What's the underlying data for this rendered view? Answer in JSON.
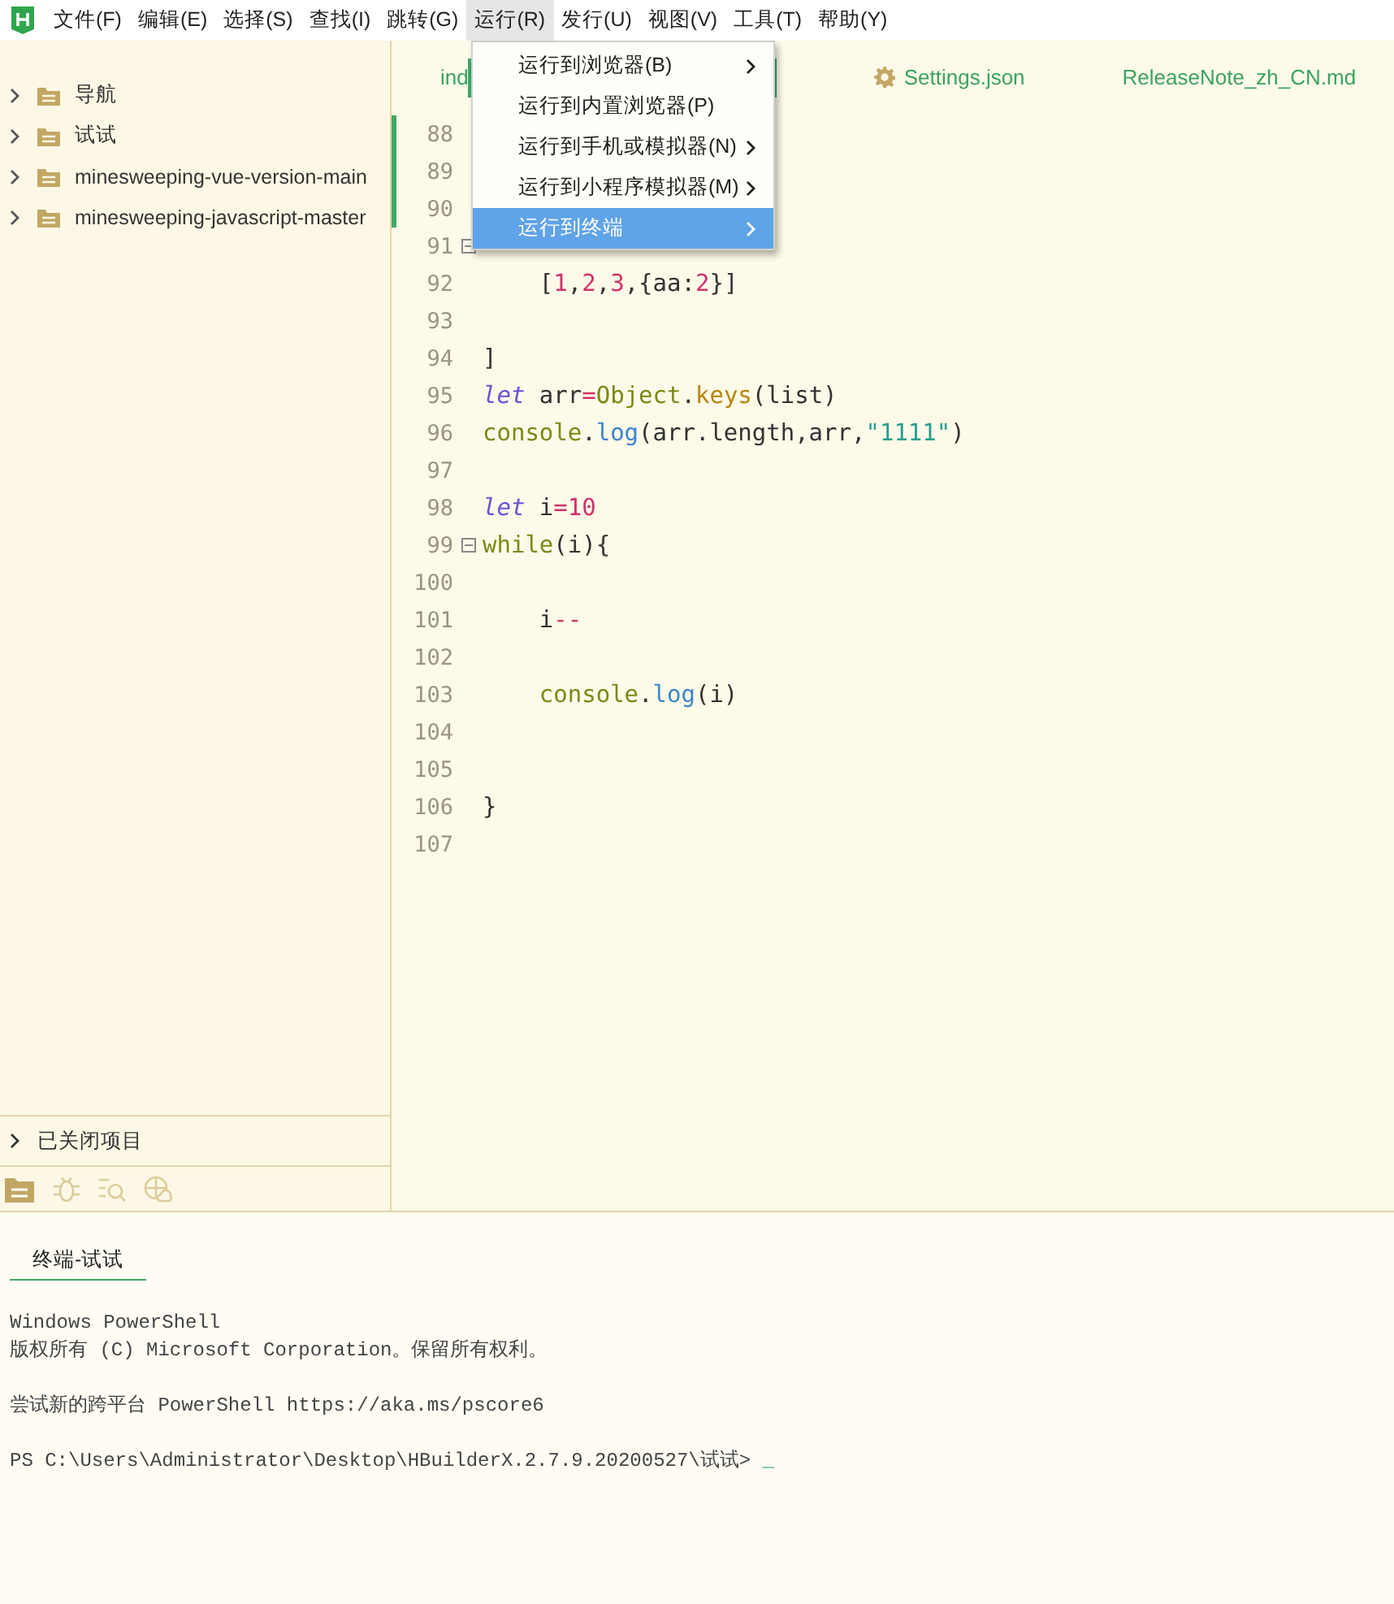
{
  "menubar": {
    "items": [
      {
        "label": "文件(F)",
        "selected": false
      },
      {
        "label": "编辑(E)",
        "selected": false
      },
      {
        "label": "选择(S)",
        "selected": false
      },
      {
        "label": "查找(I)",
        "selected": false
      },
      {
        "label": "跳转(G)",
        "selected": false
      },
      {
        "label": "运行(R)",
        "selected": true
      },
      {
        "label": "发行(U)",
        "selected": false
      },
      {
        "label": "视图(V)",
        "selected": false
      },
      {
        "label": "工具(T)",
        "selected": false
      },
      {
        "label": "帮助(Y)",
        "selected": false
      }
    ]
  },
  "run_menu": {
    "items": [
      {
        "label": "运行到浏览器(B)",
        "submenu": true,
        "selected": false
      },
      {
        "label": "运行到内置浏览器(P)",
        "submenu": false,
        "selected": false
      },
      {
        "label": "运行到手机或模拟器(N)",
        "submenu": true,
        "selected": false
      },
      {
        "label": "运行到小程序模拟器(M)",
        "submenu": true,
        "selected": false
      },
      {
        "label": "运行到终端",
        "submenu": true,
        "selected": true
      }
    ]
  },
  "sidebar": {
    "items": [
      {
        "label": "导航",
        "expanded": false
      },
      {
        "label": "试试",
        "expanded": false
      },
      {
        "label": "minesweeping-vue-version-main",
        "expanded": false
      },
      {
        "label": "minesweeping-javascript-master",
        "expanded": false
      }
    ],
    "closed_projects": {
      "label": "已关闭项目",
      "expanded": false
    }
  },
  "editor": {
    "tabs": [
      {
        "label": "ind",
        "selected": false,
        "kind": "file"
      },
      {
        "selected": true,
        "kind": "file"
      },
      {
        "label": "Settings.json",
        "selected": false,
        "kind": "settings"
      },
      {
        "label": "ReleaseNote_zh_CN.md",
        "selected": false,
        "kind": "file"
      }
    ],
    "lines": [
      {
        "number": "88",
        "modified": true,
        "fold": false
      },
      {
        "number": "89",
        "modified": true,
        "fold": false
      },
      {
        "number": "90",
        "modified": true,
        "fold": false
      },
      {
        "number": "91",
        "modified": false,
        "fold": true
      },
      {
        "number": "92",
        "modified": false,
        "fold": false,
        "tokens": [
          {
            "kind": "plain",
            "text": "    ["
          },
          {
            "kind": "number",
            "text": "1"
          },
          {
            "kind": "plain",
            "text": ","
          },
          {
            "kind": "number",
            "text": "2"
          },
          {
            "kind": "plain",
            "text": ","
          },
          {
            "kind": "number",
            "text": "3"
          },
          {
            "kind": "plain",
            "text": ",{aa:"
          },
          {
            "kind": "number",
            "text": "2"
          },
          {
            "kind": "plain",
            "text": "}]"
          }
        ]
      },
      {
        "number": "93",
        "modified": false,
        "fold": false
      },
      {
        "number": "94",
        "modified": false,
        "fold": false,
        "tokens": [
          {
            "kind": "plain",
            "text": "]"
          }
        ]
      },
      {
        "number": "95",
        "modified": false,
        "fold": false,
        "tokens": [
          {
            "kind": "keyword",
            "text": "let"
          },
          {
            "kind": "plain",
            "text": " arr"
          },
          {
            "kind": "operator",
            "text": "="
          },
          {
            "kind": "object",
            "text": "Object"
          },
          {
            "kind": "plain",
            "text": "."
          },
          {
            "kind": "method",
            "text": "keys"
          },
          {
            "kind": "plain",
            "text": "(list)"
          }
        ]
      },
      {
        "number": "96",
        "modified": false,
        "fold": false,
        "tokens": [
          {
            "kind": "object",
            "text": "console"
          },
          {
            "kind": "plain",
            "text": "."
          },
          {
            "kind": "call",
            "text": "log"
          },
          {
            "kind": "plain",
            "text": "(arr.length,arr,"
          },
          {
            "kind": "string",
            "text": "\"1111\""
          },
          {
            "kind": "plain",
            "text": ")"
          }
        ]
      },
      {
        "number": "97",
        "modified": false,
        "fold": false
      },
      {
        "number": "98",
        "modified": false,
        "fold": false,
        "tokens": [
          {
            "kind": "keyword",
            "text": "let"
          },
          {
            "kind": "plain",
            "text": " i"
          },
          {
            "kind": "operator",
            "text": "="
          },
          {
            "kind": "number",
            "text": "10"
          }
        ]
      },
      {
        "number": "99",
        "modified": false,
        "fold": true,
        "tokens": [
          {
            "kind": "object",
            "text": "while"
          },
          {
            "kind": "plain",
            "text": "(i){"
          }
        ]
      },
      {
        "number": "100",
        "modified": false,
        "fold": false
      },
      {
        "number": "101",
        "modified": false,
        "fold": false,
        "tokens": [
          {
            "kind": "plain",
            "text": "    i"
          },
          {
            "kind": "operator",
            "text": "--"
          }
        ]
      },
      {
        "number": "102",
        "modified": false,
        "fold": false
      },
      {
        "number": "103",
        "modified": false,
        "fold": false,
        "tokens": [
          {
            "kind": "object",
            "text": "    console"
          },
          {
            "kind": "plain",
            "text": "."
          },
          {
            "kind": "call",
            "text": "log"
          },
          {
            "kind": "plain",
            "text": "(i)"
          }
        ]
      },
      {
        "number": "104",
        "modified": false,
        "fold": false
      },
      {
        "number": "105",
        "modified": false,
        "fold": false
      },
      {
        "number": "106",
        "modified": false,
        "fold": false,
        "tokens": [
          {
            "kind": "plain",
            "text": "}"
          }
        ]
      },
      {
        "number": "107",
        "modified": false,
        "fold": false
      }
    ]
  },
  "terminal": {
    "tab": {
      "label": "终端-试试",
      "selected": true
    },
    "paragraphs": [
      [
        "Windows PowerShell",
        "版权所有 (C) Microsoft Corporation。保留所有权利。"
      ],
      [
        "尝试新的跨平台 PowerShell https://aka.ms/pscore6"
      ],
      [
        "PS C:\\Users\\Administrator\\Desktop\\HBuilderX.2.7.9.20200527\\试试> "
      ]
    ],
    "cursor": "_"
  }
}
